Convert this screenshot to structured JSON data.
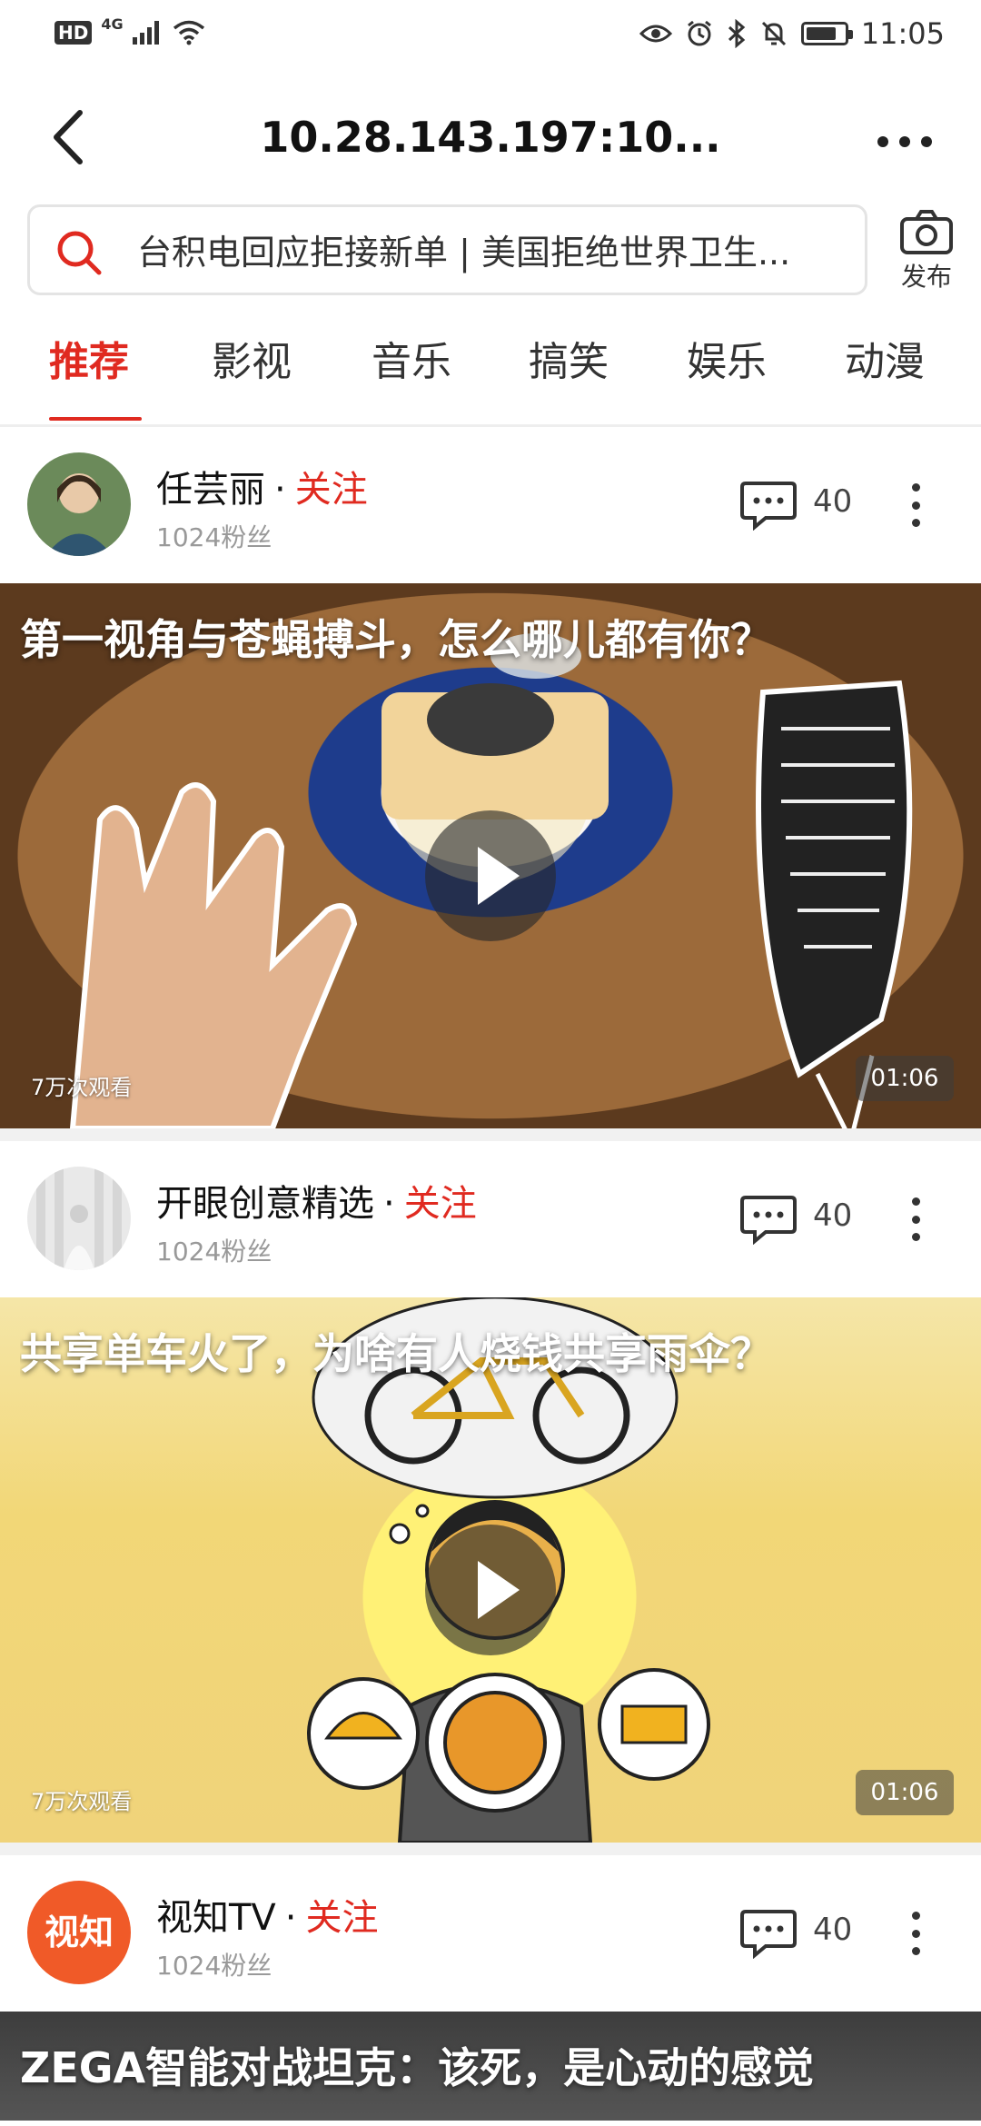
{
  "status_bar": {
    "network_badge": "HD",
    "network_type": "4G",
    "time": "11:05",
    "icons": [
      "signal-icon",
      "wifi-icon",
      "eye-icon",
      "alarm-icon",
      "bluetooth-icon",
      "mute-bell-icon",
      "battery-icon"
    ]
  },
  "header": {
    "title": "10.28.143.197:10...",
    "back_icon": "back-arrow-icon",
    "more_icon": "more-dots-icon"
  },
  "search": {
    "placeholder": "台积电回应拒接新单 | 美国拒绝世界卫生...",
    "icon": "search-icon"
  },
  "publish": {
    "label": "发布",
    "icon": "camera-icon"
  },
  "tabs": [
    {
      "label": "推荐",
      "active": true
    },
    {
      "label": "影视",
      "active": false
    },
    {
      "label": "音乐",
      "active": false
    },
    {
      "label": "搞笑",
      "active": false
    },
    {
      "label": "娱乐",
      "active": false
    },
    {
      "label": "动漫",
      "active": false
    }
  ],
  "feed": [
    {
      "author": "任芸丽",
      "follow_label": "关注",
      "fans": "1024粉丝",
      "comments": "40",
      "video_title": "第一视角与苍蝇搏斗，怎么哪儿都有你？",
      "views": "7万次观看",
      "duration": "01:06"
    },
    {
      "author": "开眼创意精选",
      "follow_label": "关注",
      "fans": "1024粉丝",
      "comments": "40",
      "video_title": "共享单车火了，为啥有人烧钱共享雨伞？",
      "views": "7万次观看",
      "duration": "01:06"
    },
    {
      "author": "视知TV",
      "follow_label": "关注",
      "fans": "1024粉丝",
      "comments": "40",
      "video_title": "ZEGA智能对战坦克：该死，是心动的感觉",
      "avatar_text": "视知"
    }
  ],
  "colors": {
    "accent": "#e02a20",
    "text_primary": "#111111",
    "text_secondary": "#999999",
    "divider": "#eeeeee"
  }
}
